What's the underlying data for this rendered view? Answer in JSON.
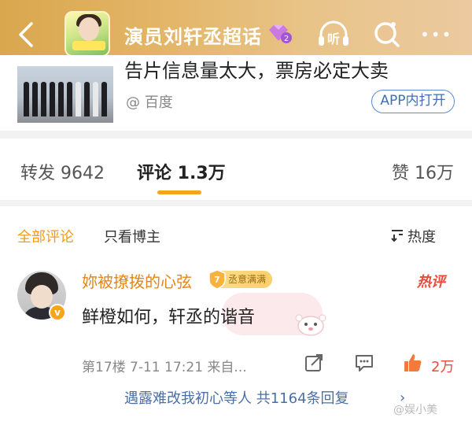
{
  "header": {
    "title": "演员刘轩丞超话",
    "level_badge": "2",
    "icons": [
      "back-icon",
      "listen-icon",
      "search-icon",
      "more-icon"
    ],
    "listen_label": "听",
    "more_label": "•••"
  },
  "card": {
    "text": "告片信息量太大，票房必定大卖",
    "source": "@ 百度",
    "app_button": "APP内打开"
  },
  "tabs": {
    "repost": "转发 9642",
    "comment": "评论 1.3万",
    "like": "赞 16万"
  },
  "filter": {
    "all": "全部评论",
    "op_only": "只看博主",
    "sort": "热度"
  },
  "comment": {
    "author": "妳被撩拨的心弦",
    "fan_level": "7",
    "fan_badge": "丞意满满",
    "hot_label": "热评",
    "text": "鲜橙如何，轩丞的谐音",
    "meta": "第17楼 7-11 17:21 来自...",
    "likes": "2万",
    "reply_summary": "遇露难改我初心等人  共1164条回复",
    "reply_chevron": "›"
  },
  "watermark": "@娱小美",
  "colors": {
    "accent": "#f6a51b",
    "header_gradient_start": "#d9a74d",
    "hot_red": "#e94b3c",
    "link_blue": "#4a6fa5"
  }
}
